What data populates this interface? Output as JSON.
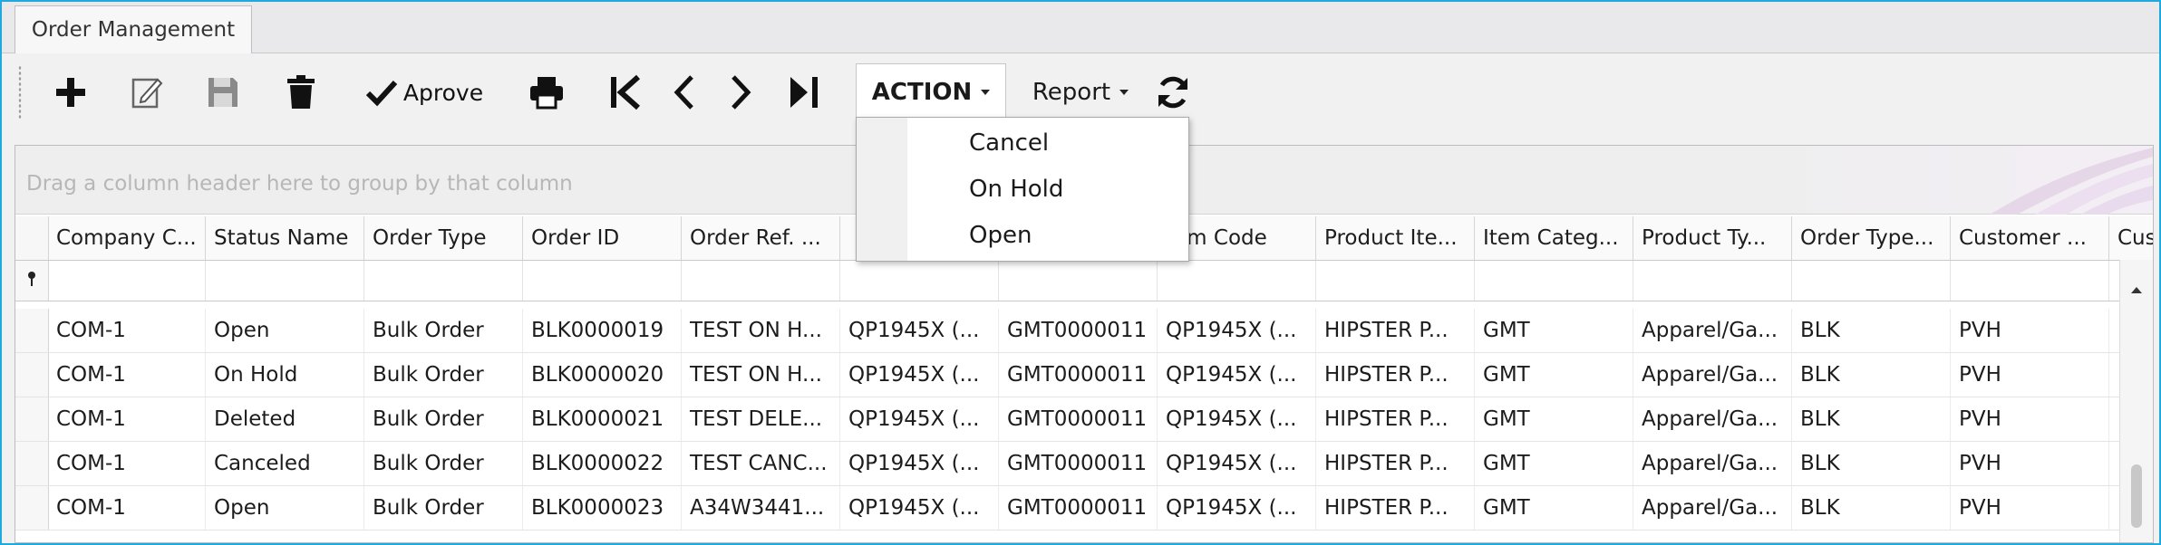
{
  "window": {
    "tab_title": "Order Management"
  },
  "toolbar": {
    "buttons": [
      {
        "name": "add-button",
        "icon": "plus-icon"
      },
      {
        "name": "edit-button",
        "icon": "edit-icon"
      },
      {
        "name": "save-button",
        "icon": "save-icon"
      },
      {
        "name": "delete-button",
        "icon": "trash-icon"
      },
      {
        "name": "approve-button",
        "icon": "check-icon",
        "label": "Aprove"
      },
      {
        "name": "print-button",
        "icon": "printer-icon"
      },
      {
        "name": "first-record-button",
        "icon": "first-icon"
      },
      {
        "name": "prev-record-button",
        "icon": "chevron-left-icon"
      },
      {
        "name": "next-record-button",
        "icon": "chevron-right-icon"
      },
      {
        "name": "last-record-button",
        "icon": "last-icon"
      }
    ],
    "approve_label": "Aprove",
    "action_label": "ACTION",
    "report_label": "Report",
    "refresh_icon": "refresh-icon"
  },
  "action_menu": {
    "items": [
      {
        "label": "Cancel"
      },
      {
        "label": "On Hold"
      },
      {
        "label": "Open"
      }
    ]
  },
  "grid": {
    "group_panel_text": "Drag a column header here to group by that column",
    "columns": [
      "Company C...",
      "Status Name",
      "Order Type",
      "Order ID",
      "Order Ref. ...",
      "",
      "",
      "tem Code",
      "Product Ite...",
      "Item Categ...",
      "Product Ty...",
      "Order Type...",
      "Customer ...",
      "Cus"
    ],
    "rows": [
      [
        "COM-1",
        "Open",
        "Bulk Order",
        "BLK0000019",
        "TEST ON H...",
        "QP1945X (...",
        "GMT0000011",
        "QP1945X (...",
        "HIPSTER P...",
        "GMT",
        "Apparel/Ga...",
        "BLK",
        "PVH",
        ""
      ],
      [
        "COM-1",
        "On Hold",
        "Bulk Order",
        "BLK0000020",
        "TEST ON H...",
        "QP1945X (...",
        "GMT0000011",
        "QP1945X (...",
        "HIPSTER P...",
        "GMT",
        "Apparel/Ga...",
        "BLK",
        "PVH",
        ""
      ],
      [
        "COM-1",
        "Deleted",
        "Bulk Order",
        "BLK0000021",
        "TEST DELE...",
        "QP1945X (...",
        "GMT0000011",
        "QP1945X (...",
        "HIPSTER P...",
        "GMT",
        "Apparel/Ga...",
        "BLK",
        "PVH",
        ""
      ],
      [
        "COM-1",
        "Canceled",
        "Bulk Order",
        "BLK0000022",
        "TEST CANC...",
        "QP1945X (...",
        "GMT0000011",
        "QP1945X (...",
        "HIPSTER P...",
        "GMT",
        "Apparel/Ga...",
        "BLK",
        "PVH",
        ""
      ],
      [
        "COM-1",
        "Open",
        "Bulk Order",
        "BLK0000023",
        "A34W3441...",
        "QP1945X (...",
        "GMT0000011",
        "QP1945X (...",
        "HIPSTER P...",
        "GMT",
        "Apparel/Ga...",
        "BLK",
        "PVH",
        ""
      ]
    ]
  },
  "colors": {
    "window_border": "#1fa9df",
    "toolbar_bg": "#f1f1f1",
    "group_panel_text": "#b7b7b7"
  }
}
